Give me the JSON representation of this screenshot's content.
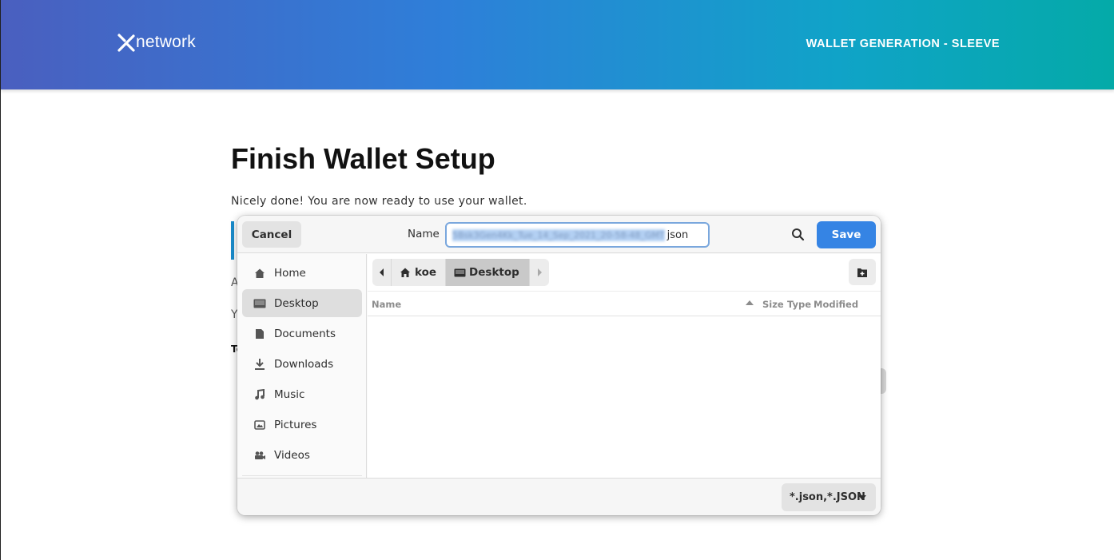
{
  "header": {
    "logo_text": "network",
    "right_title": "WALLET GENERATION - SLEEVE"
  },
  "main": {
    "title": "Finish Wallet Setup",
    "subtitle": "Nicely done! You are now ready to use your wallet.",
    "partial_a": "A",
    "partial_y": "Y",
    "partial_t": "To"
  },
  "dialog": {
    "cancel_label": "Cancel",
    "name_label": "Name",
    "filename_selected": "5Bsk3Gen4Kk_Tue_14_Sep_2021_20-58-48_GMT",
    "filename_ext": "json",
    "save_label": "Save",
    "sidebar": [
      {
        "label": "Home",
        "icon": "home-icon"
      },
      {
        "label": "Desktop",
        "icon": "desktop-icon",
        "active": true
      },
      {
        "label": "Documents",
        "icon": "document-icon"
      },
      {
        "label": "Downloads",
        "icon": "download-icon"
      },
      {
        "label": "Music",
        "icon": "music-icon"
      },
      {
        "label": "Pictures",
        "icon": "pictures-icon"
      },
      {
        "label": "Videos",
        "icon": "videos-icon"
      }
    ],
    "pathbar": {
      "home": "koe",
      "current": "Desktop"
    },
    "columns": {
      "name": "Name",
      "size": "Size",
      "type": "Type",
      "modified": "Modified"
    },
    "filter": "*.json,*.JSON"
  }
}
